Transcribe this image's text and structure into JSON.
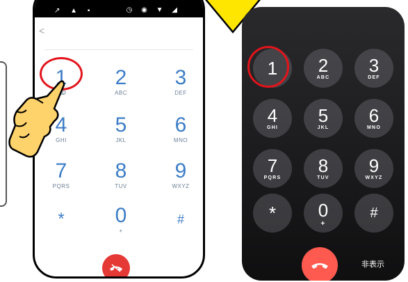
{
  "android": {
    "keys": [
      {
        "digit": "1",
        "letters": ""
      },
      {
        "digit": "2",
        "letters": "ABC"
      },
      {
        "digit": "3",
        "letters": "DEF"
      },
      {
        "digit": "4",
        "letters": "GHI"
      },
      {
        "digit": "5",
        "letters": "JKL"
      },
      {
        "digit": "6",
        "letters": "MNO"
      },
      {
        "digit": "7",
        "letters": "PQRS"
      },
      {
        "digit": "8",
        "letters": "TUV"
      },
      {
        "digit": "9",
        "letters": "WXYZ"
      },
      {
        "digit": "*",
        "letters": ""
      },
      {
        "digit": "0",
        "letters": "+"
      },
      {
        "digit": "#",
        "letters": ""
      }
    ],
    "voicemail_icon": "voicemail-icon",
    "end_call_icon": "end-call-icon"
  },
  "iphone": {
    "keys": [
      {
        "digit": "1",
        "letters": ""
      },
      {
        "digit": "2",
        "letters": "ABC"
      },
      {
        "digit": "3",
        "letters": "DEF"
      },
      {
        "digit": "4",
        "letters": "GHI"
      },
      {
        "digit": "5",
        "letters": "JKL"
      },
      {
        "digit": "6",
        "letters": "MNO"
      },
      {
        "digit": "7",
        "letters": "PQRS"
      },
      {
        "digit": "8",
        "letters": "TUV"
      },
      {
        "digit": "9",
        "letters": "WXYZ"
      },
      {
        "digit": "*",
        "letters": ""
      },
      {
        "digit": "0",
        "letters": "+"
      },
      {
        "digit": "#",
        "letters": ""
      }
    ],
    "hide_label": "非表示",
    "end_call_icon": "end-call-icon"
  },
  "colors": {
    "android_key": "#3d7dc6",
    "end_call_red": "#e53935",
    "iphone_end_call": "#ff5a4f",
    "highlight": "#e3141b",
    "hand_fill": "#ffd36b",
    "arrow_fill": "#ffe600"
  }
}
